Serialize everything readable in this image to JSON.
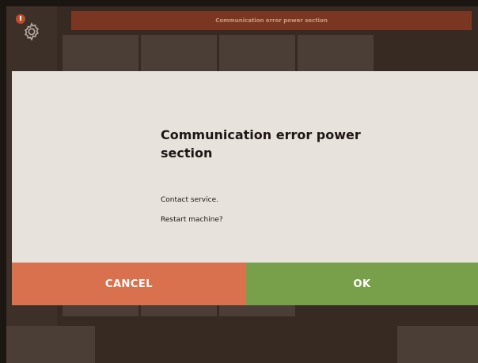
{
  "banner": {
    "text": "Communication error power section"
  },
  "icons": {
    "settings": "gear-icon",
    "alert": "alert-badge-icon"
  },
  "dialog": {
    "title": "Communication error power section",
    "lines": [
      "Contact service.",
      "Restart machine?"
    ],
    "cancel_label": "CANCEL",
    "ok_label": "OK"
  },
  "colors": {
    "cancel": "#d9704e",
    "ok": "#78a04a",
    "banner": "#7a3620",
    "dialog_bg": "#e8e2dd"
  }
}
